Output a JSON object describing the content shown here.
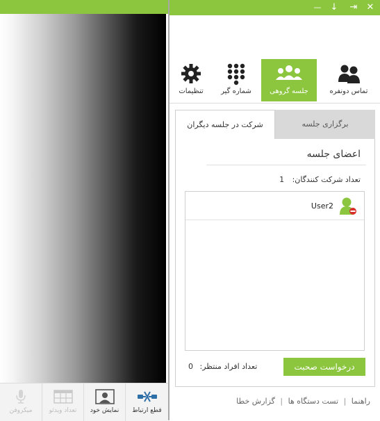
{
  "left_panel": {
    "bottom_bar": {
      "disconnect_label": "قطع ارتباط",
      "self_view_label": "نمایش خود",
      "video_count_label": "تعداد ویدئو",
      "microphone_label": "میکروفن"
    }
  },
  "window": {
    "close_glyph": "✕",
    "minimize_glyph": "—",
    "dock_glyph": "↓",
    "detach_glyph": "⇥"
  },
  "nav": {
    "items": [
      {
        "label": "تماس دونفره",
        "icon": "two-users-icon"
      },
      {
        "label": "جلسه گروهی",
        "icon": "group-icon",
        "active": true
      },
      {
        "label": "شماره گیر",
        "icon": "dialpad-icon"
      },
      {
        "label": "تنظیمات",
        "icon": "gear-icon"
      }
    ]
  },
  "tabs": {
    "host_meeting": "برگزاری جلسه",
    "join_other_meeting": "شرکت در جلسه دیگران"
  },
  "meeting": {
    "members_title": "اعضای جلسه",
    "participant_count_label": "تعداد شرکت کنندگان:",
    "participant_count": "1",
    "members": [
      {
        "name": "User2",
        "icon": "user-muted-icon"
      }
    ],
    "request_floor_button": "درخواست صحبت",
    "waiting_label": "تعداد افراد منتظر:",
    "waiting_count": "0"
  },
  "footer": {
    "help": "راهنما",
    "device_test": "تست دستگاه ها",
    "report_error": "گزارش خطا",
    "separator": "|"
  },
  "colors": {
    "accent": "#8cc63f",
    "tab_inactive": "#d9d9d9",
    "border": "#cfcfcf"
  }
}
